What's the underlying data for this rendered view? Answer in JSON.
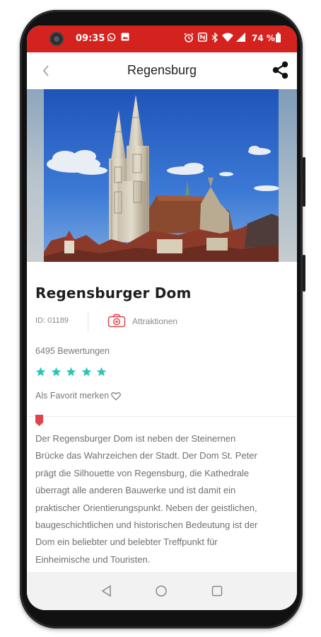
{
  "status_bar": {
    "time": "09:35",
    "battery_text": "74 %",
    "icons": [
      "whatsapp-icon",
      "image-icon",
      "alarm-icon",
      "nfc-icon",
      "bluetooth-icon",
      "wifi-icon",
      "signal-icon",
      "battery-icon"
    ],
    "background_color": "#d4231e"
  },
  "app_bar": {
    "title": "Regensburg",
    "back_icon": "chevron-left-icon",
    "share_icon": "share-icon"
  },
  "hero_image": {
    "description_icon": "cathedral-photo"
  },
  "poi": {
    "title": "Regensburger Dom",
    "id_label": "ID: 01189",
    "category": "Attraktionen",
    "category_icon": "camera-icon",
    "reviews": "6495 Bewertungen",
    "rating": 5,
    "rating_max": 5,
    "star_color": "#2cc5b6",
    "favorite_label": "Als Favorit merken",
    "accent_color": "#e2434b",
    "description_lines": [
      "Der Regensburger Dom ist neben der Steinernen",
      "Brücke das Wahrzeichen der Stadt. Der Dom St. Peter",
      "prägt die Silhouette von Regensburg, die Kathedrale",
      "überragt alle anderen Bauwerke und ist damit ein",
      "praktischer Orientierungspunkt. Neben der geistlichen,",
      "baugeschichtlichen und historischen Bedeutung ist der",
      "Dom ein beliebter und belebter Treffpunkt für",
      "Einheimische und Touristen."
    ]
  },
  "nav_bar": {
    "icons": [
      "nav-back-icon",
      "nav-home-icon",
      "nav-recents-icon"
    ]
  }
}
